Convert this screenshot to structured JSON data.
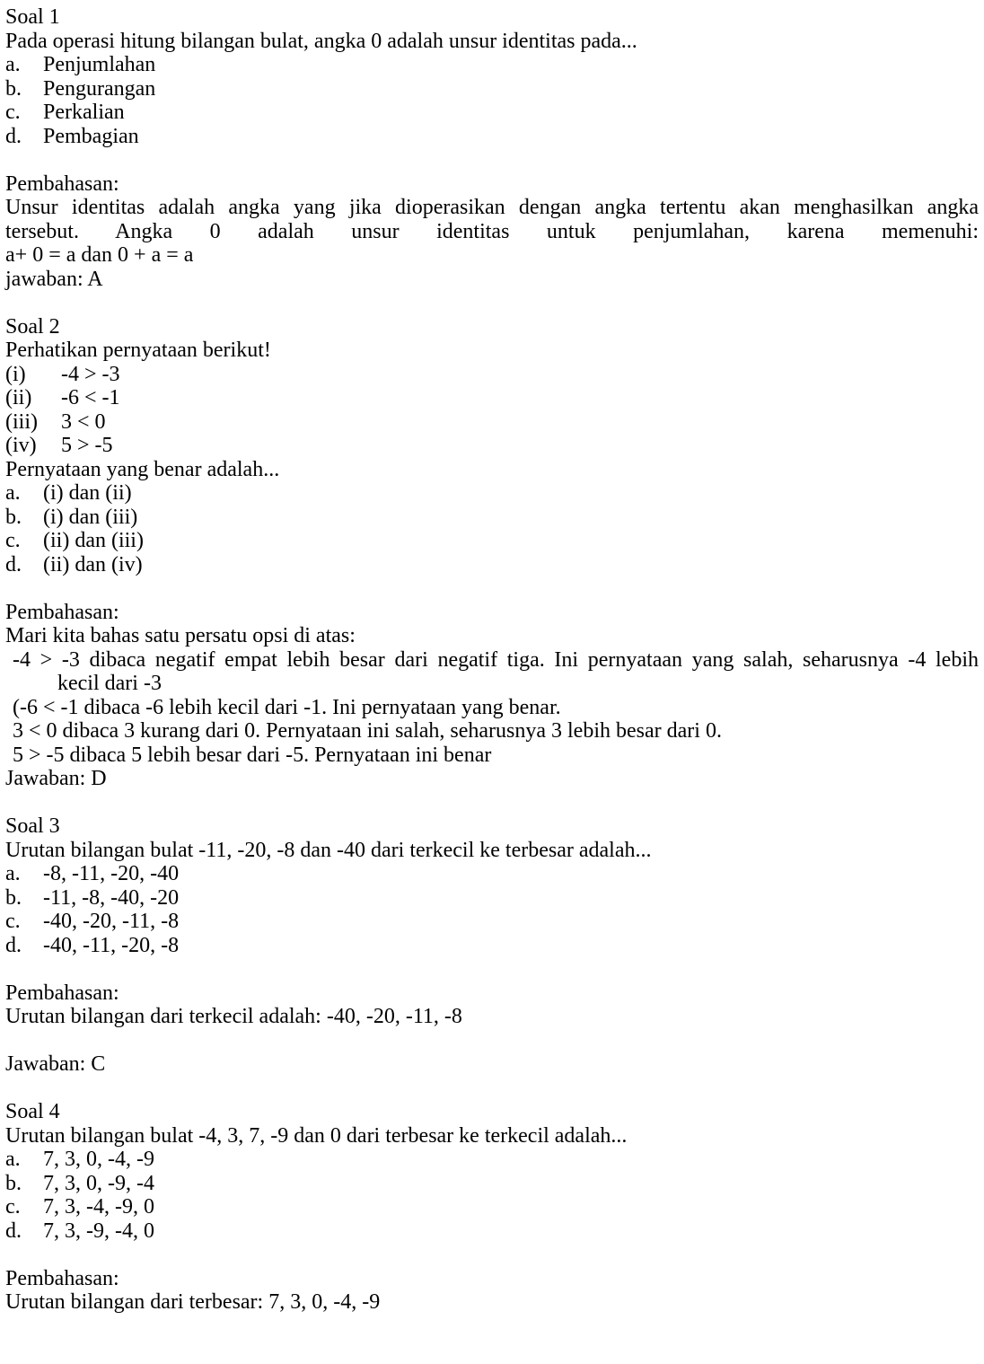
{
  "soal1": {
    "title": "Soal 1",
    "question": "Pada operasi hitung bilangan bulat, angka 0 adalah unsur identitas pada...",
    "options": [
      {
        "label": "a.",
        "text": "Penjumlahan"
      },
      {
        "label": "b.",
        "text": "Pengurangan"
      },
      {
        "label": "c.",
        "text": "Perkalian"
      },
      {
        "label": "d.",
        "text": "Pembagian"
      }
    ],
    "pembahasan_title": "Pembahasan:",
    "pembahasan_line1": "Unsur identitas adalah angka yang jika dioperasikan dengan angka tertentu akan menghasilkan angka",
    "pembahasan_line2": "tersebut. Angka 0 adalah unsur identitas untuk penjumlahan, karena memenuhi:",
    "pembahasan_line3": "a+ 0 = a dan 0 + a = a",
    "answer": "jawaban: A"
  },
  "soal2": {
    "title": "Soal 2",
    "intro": "Perhatikan pernyataan berikut!",
    "statements": [
      {
        "label": "(i)",
        "text": "-4 > -3"
      },
      {
        "label": "(ii)",
        "text": "-6 < -1"
      },
      {
        "label": "(iii)",
        "text": "3 < 0"
      },
      {
        "label": "(iv)",
        "text": "5 > -5"
      }
    ],
    "question": "Pernyataan yang benar adalah...",
    "options": [
      {
        "label": "a.",
        "text": "(i) dan (ii)"
      },
      {
        "label": "b.",
        "text": "(i) dan (iii)"
      },
      {
        "label": "c.",
        "text": "(ii) dan (iii)"
      },
      {
        "label": "d.",
        "text": "(ii) dan (iv)"
      }
    ],
    "pembahasan_title": "Pembahasan:",
    "pembahasan_intro": "Mari kita bahas satu persatu opsi di atas:",
    "discussion_1a": "-4 > -3 dibaca negatif empat lebih besar dari negatif tiga. Ini pernyataan yang salah, seharusnya -4 lebih",
    "discussion_1b": "kecil dari -3",
    "discussion_2": "(-6 < -1 dibaca -6 lebih kecil dari -1. Ini pernyataan yang benar.",
    "discussion_3": "3 < 0 dibaca 3 kurang dari 0. Pernyataan ini salah, seharusnya 3 lebih besar dari 0.",
    "discussion_4": "5 > -5 dibaca 5 lebih besar dari -5. Pernyataan ini benar",
    "answer": "Jawaban: D"
  },
  "soal3": {
    "title": "Soal 3",
    "question": "Urutan bilangan bulat -11, -20, -8 dan -40 dari terkecil ke terbesar adalah...",
    "options": [
      {
        "label": "a.",
        "text": "-8, -11, -20, -40"
      },
      {
        "label": "b.",
        "text": "-11, -8, -40, -20"
      },
      {
        "label": "c.",
        "text": "-40, -20, -11, -8"
      },
      {
        "label": "d.",
        "text": "-40, -11, -20, -8"
      }
    ],
    "pembahasan_title": "Pembahasan:",
    "pembahasan_text": "Urutan bilangan dari terkecil adalah: -40, -20, -11, -8",
    "answer": "Jawaban: C"
  },
  "soal4": {
    "title": "Soal 4",
    "question": "Urutan bilangan bulat -4, 3, 7, -9 dan 0 dari terbesar ke terkecil adalah...",
    "options": [
      {
        "label": "a.",
        "text": "7, 3, 0, -4, -9"
      },
      {
        "label": "b.",
        "text": "7, 3, 0, -9, -4"
      },
      {
        "label": "c.",
        "text": "7, 3, -4, -9, 0"
      },
      {
        "label": "d.",
        "text": "7, 3, -9, -4, 0"
      }
    ],
    "pembahasan_title": "Pembahasan:",
    "pembahasan_text": "Urutan bilangan dari terbesar: 7, 3, 0, -4, -9"
  }
}
